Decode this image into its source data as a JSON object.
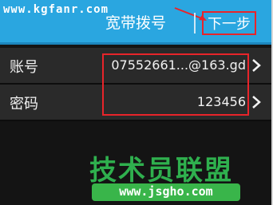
{
  "header": {
    "watermark": "www.kgfanr.com",
    "title": "宽带拨号",
    "next_label": "下一步"
  },
  "form": {
    "rows": [
      {
        "label": "账号",
        "value": "07552661...@163.gd"
      },
      {
        "label": "密码",
        "value": "123456"
      }
    ]
  },
  "branding": {
    "logo_text": "技术员联盟",
    "url": "www.jsgho.com"
  },
  "colors": {
    "header_bg": "#2aa6e0",
    "row_bg": "#2a2a2a",
    "annotation_red": "#e8242a",
    "brand_green": "#39b54a"
  }
}
